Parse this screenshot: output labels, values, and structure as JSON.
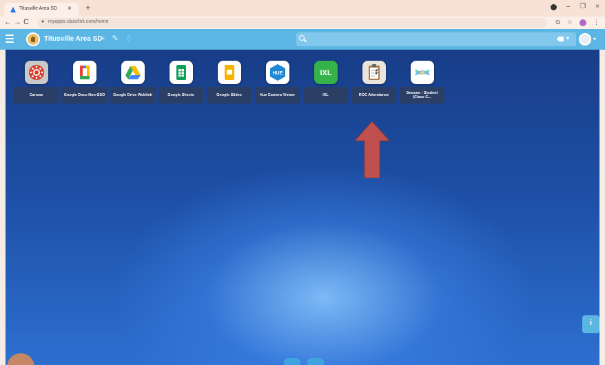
{
  "browser": {
    "tab_title": "Titusville Area SD",
    "tab_close": "×",
    "new_tab": "+",
    "url": "myapps.classlink.com/home",
    "window_minimize": "–",
    "window_restore": "❐",
    "window_close": "×",
    "nav_back": "←",
    "nav_forward": "→",
    "nav_reload": "C",
    "addr_icons": [
      "⧉",
      "☆",
      "⋮"
    ]
  },
  "header": {
    "org_name": "Titusville Area SD",
    "tools": [
      "+",
      "✎",
      "♢"
    ],
    "search_placeholder": "",
    "accent_color": "#5bb6e4"
  },
  "apps": [
    {
      "label": "Canvas",
      "icon": "canvas-icon"
    },
    {
      "label": "Google Docs Non-SSO",
      "icon": "google-docs-icon"
    },
    {
      "label": "Google Drive Weblink",
      "icon": "google-drive-icon"
    },
    {
      "label": "Google Sheets",
      "icon": "google-sheets-icon"
    },
    {
      "label": "Google Slides",
      "icon": "google-slides-icon"
    },
    {
      "label": "Hue Camera Viewer",
      "icon": "hue-camera-icon"
    },
    {
      "label": "IXL",
      "icon": "ixl-icon"
    },
    {
      "label": "ROC Attendance",
      "icon": "roc-attendance-icon"
    },
    {
      "label": "Seesaw - Student (Class C...",
      "icon": "seesaw-icon"
    }
  ],
  "icon_text": {
    "hue": "HUE",
    "ixl": "IXL"
  },
  "annotation": {
    "arrow_color": "#c0504d",
    "points_to": "ROC Attendance"
  }
}
